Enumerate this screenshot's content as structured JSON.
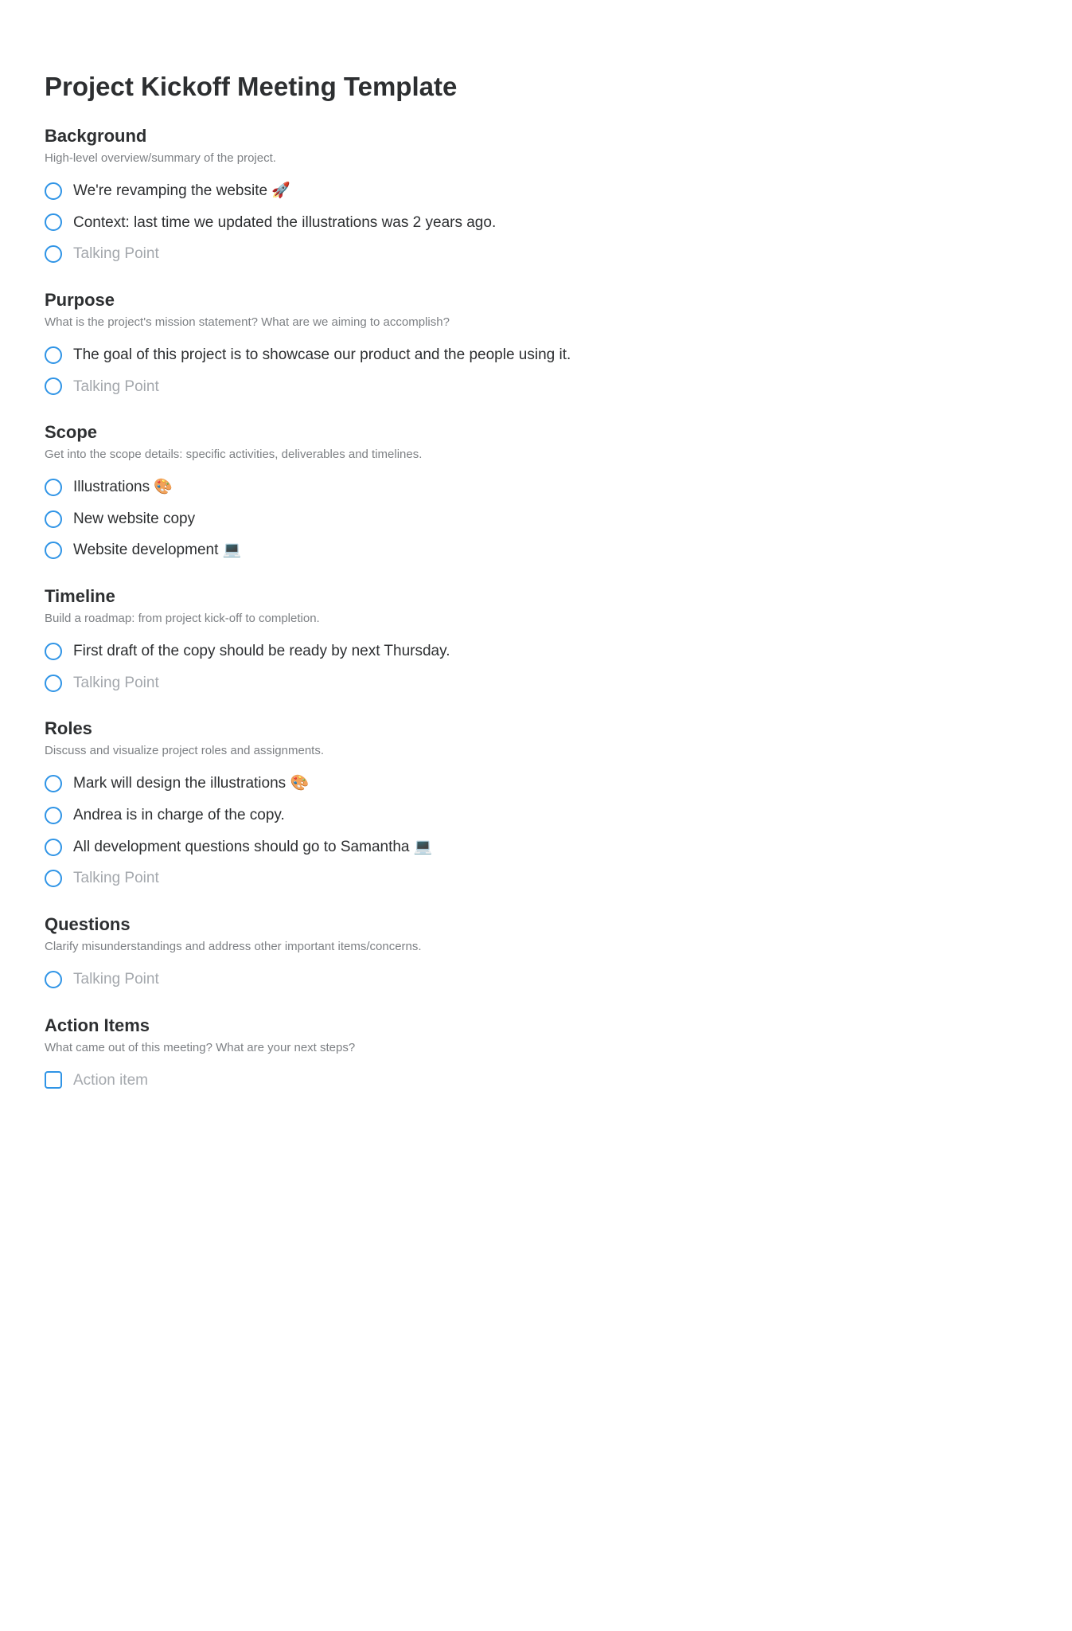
{
  "title": "Project Kickoff Meeting Template",
  "placeholders": {
    "talking_point": "Talking Point",
    "action_item": "Action item"
  },
  "sections": {
    "background": {
      "heading": "Background",
      "desc": "High-level overview/summary of the project.",
      "items": [
        "We're revamping the website 🚀",
        "Context: last time we updated the illustrations was 2 years ago."
      ]
    },
    "purpose": {
      "heading": "Purpose",
      "desc": "What is the project's mission statement? What are we aiming to accomplish?",
      "items": [
        "The goal of this project is to showcase our product and the people using it."
      ]
    },
    "scope": {
      "heading": "Scope",
      "desc": "Get into the scope details: specific activities, deliverables and timelines.",
      "items": [
        "Illustrations 🎨",
        "New website copy",
        "Website development 💻"
      ]
    },
    "timeline": {
      "heading": "Timeline",
      "desc": "Build a roadmap: from project kick-off to completion.",
      "items": [
        "First draft of the copy should be ready by next Thursday."
      ]
    },
    "roles": {
      "heading": "Roles",
      "desc": "Discuss and visualize project roles and assignments.",
      "items": [
        "Mark will design the illustrations 🎨",
        "Andrea is in charge of the copy.",
        "All development questions should go to Samantha 💻"
      ]
    },
    "questions": {
      "heading": "Questions",
      "desc": "Clarify misunderstandings and address other important items/concerns.",
      "items": []
    },
    "action_items": {
      "heading": "Action Items",
      "desc": "What came out of this meeting? What are your next steps?",
      "items": []
    }
  }
}
